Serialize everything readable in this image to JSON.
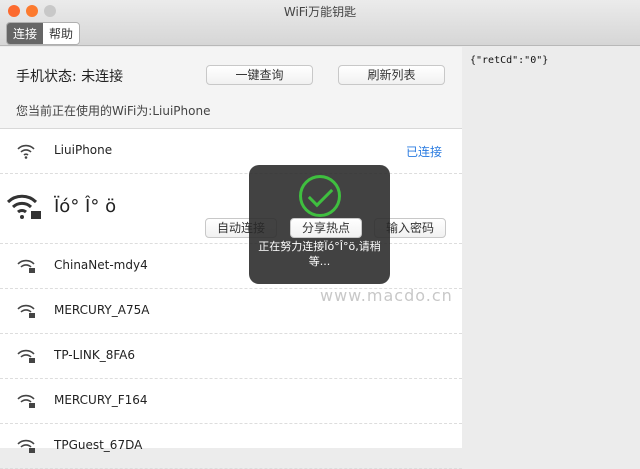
{
  "window": {
    "title": "WiFi万能钥匙"
  },
  "tabs": [
    {
      "label": "连接"
    },
    {
      "label": "帮助"
    }
  ],
  "header": {
    "status": "手机状态: 未连接",
    "query_btn": "一键查询",
    "refresh_btn": "刷新列表",
    "current": "您当前正在使用的WiFi为:LiuiPhone"
  },
  "networks": [
    {
      "name": "LiuiPhone",
      "state": "已连接"
    },
    {
      "name": "Ïó° Î° ö"
    },
    {
      "name": "ChinaNet-mdy4"
    },
    {
      "name": "MERCURY_A75A"
    },
    {
      "name": "TP-LINK_8FA6"
    },
    {
      "name": "MERCURY_F164"
    },
    {
      "name": "TPGuest_67DA"
    }
  ],
  "actions": {
    "auto": "自动连接",
    "share": "分享热点",
    "password": "输入密码"
  },
  "toast": {
    "message": "正在努力连接Ïó°Î°ö,请稍等..."
  },
  "response": "{\"retCd\":\"0\"}",
  "watermark": "www.macdo.cn"
}
